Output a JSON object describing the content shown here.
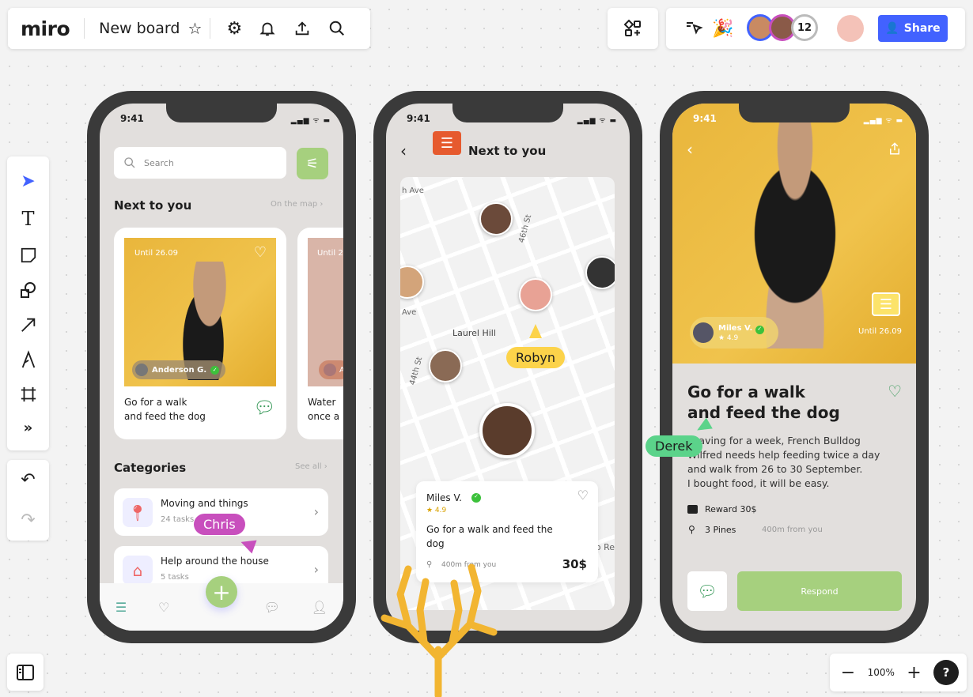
{
  "topbar": {
    "logo": "miro",
    "board_title": "New board",
    "collaborator_count": "12",
    "share_label": "Share"
  },
  "zoom": {
    "level": "100%",
    "help": "?"
  },
  "cursors": {
    "chris": "Chris",
    "robyn": "Robyn",
    "derek": "Derek"
  },
  "colors": {
    "accent": "#4262ff",
    "green": "#a6d07e",
    "chris": "#c84fbd",
    "robyn": "#fcd34a",
    "derek": "#5bd38a"
  },
  "phone1": {
    "time": "9:41",
    "search_placeholder": "Search",
    "section_title": "Next to you",
    "section_link": "On the map ›",
    "card1": {
      "until": "Until 26.09",
      "user": "Anderson G.",
      "title_line1": "Go for a walk",
      "title_line2": "and feed the dog"
    },
    "card2": {
      "until": "Until 2",
      "user": "A",
      "title_line1": "Water",
      "title_line2": "once a"
    },
    "categories_title": "Categories",
    "categories_link": "See all ›",
    "categories": [
      {
        "name": "Moving and things",
        "count": "24 tasks"
      },
      {
        "name": "Help around the house",
        "count": "5 tasks"
      }
    ]
  },
  "phone2": {
    "time": "9:41",
    "title": "Next to you",
    "map_labels": {
      "ave1": "h Ave",
      "ave2": "Ave",
      "st1": "46th St",
      "st2": "44th St",
      "area": "Laurel Hill",
      "edge": "o Re"
    },
    "card": {
      "name": "Miles V.",
      "rating": "★ 4.9",
      "title": "Go for a walk and feed the dog",
      "distance": "400m from you",
      "price": "30$"
    }
  },
  "phone3": {
    "time": "9:41",
    "user": "Miles V.",
    "rating": "★ 4.9",
    "until": "Until 26.09",
    "title_line1": "Go for a walk",
    "title_line2": "and feed the dog",
    "description": [
      "Leaving for a week, French Bulldog",
      "Wilfred needs help feeding twice a day",
      "and walk from 26 to 30 September.",
      "I bought food, it will be easy."
    ],
    "reward": "Reward 30$",
    "location": "3 Pines",
    "distance": "400m from you",
    "respond_label": "Respond"
  }
}
